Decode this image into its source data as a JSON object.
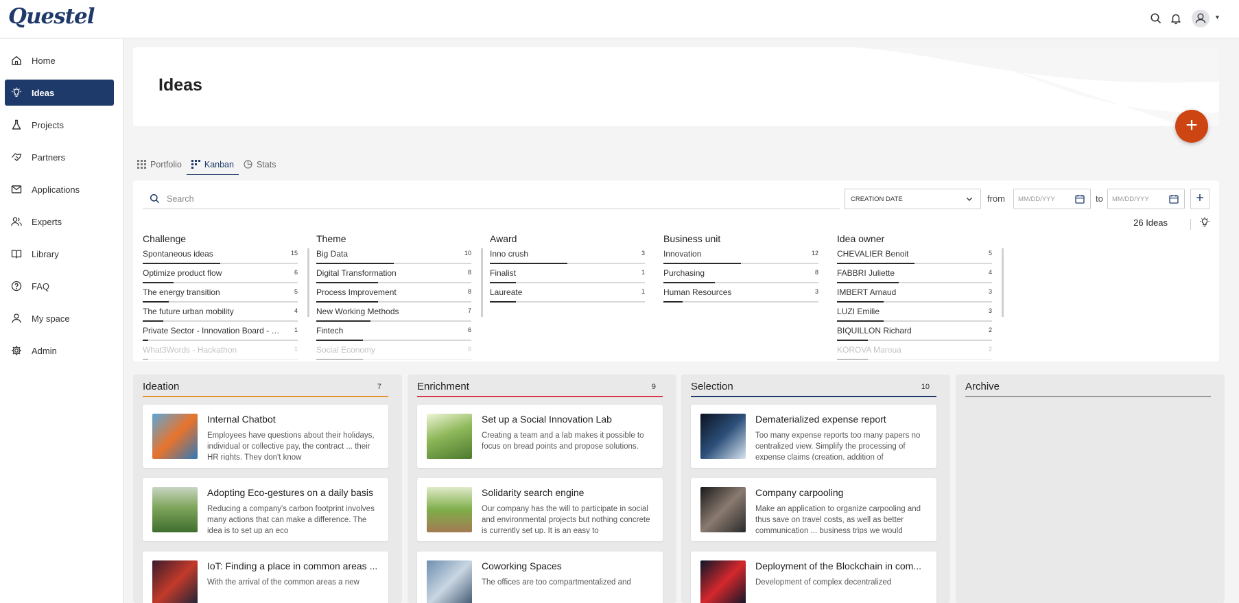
{
  "app": {
    "logo": "Questel"
  },
  "sidebar": {
    "items": [
      {
        "label": "Home",
        "icon": "home-icon"
      },
      {
        "label": "Ideas",
        "icon": "lightbulb-icon",
        "active": true
      },
      {
        "label": "Projects",
        "icon": "flask-icon"
      },
      {
        "label": "Partners",
        "icon": "handshake-icon"
      },
      {
        "label": "Applications",
        "icon": "envelope-icon"
      },
      {
        "label": "Experts",
        "icon": "users-icon"
      },
      {
        "label": "Library",
        "icon": "book-icon"
      },
      {
        "label": "FAQ",
        "icon": "question-icon"
      },
      {
        "label": "My space",
        "icon": "user-icon"
      },
      {
        "label": "Admin",
        "icon": "gear-icon"
      }
    ]
  },
  "page": {
    "title": "Ideas"
  },
  "tabs": [
    {
      "label": "Portfolio",
      "icon": "grid-icon"
    },
    {
      "label": "Kanban",
      "icon": "kanban-icon",
      "active": true
    },
    {
      "label": "Stats",
      "icon": "pie-chart-icon"
    }
  ],
  "filters": {
    "search_placeholder": "Search",
    "date_field": "CREATION DATE",
    "from_label": "from",
    "to_label": "to",
    "date_placeholder": "MM/DD/YYY",
    "ideas_count": "26 Ideas"
  },
  "facets": [
    {
      "title": "Challenge",
      "items": [
        {
          "label": "Spontaneous ideas",
          "count": 15
        },
        {
          "label": "Optimize product flow",
          "count": 6
        },
        {
          "label": "The energy transition",
          "count": 5
        },
        {
          "label": "The future urban mobility",
          "count": 4
        },
        {
          "label": "Private Sector - Innovation Board - J...",
          "count": 1
        },
        {
          "label": "What3Words - Hackathon",
          "count": 1
        }
      ]
    },
    {
      "title": "Theme",
      "items": [
        {
          "label": "Big Data",
          "count": 10
        },
        {
          "label": "Digital Transformation",
          "count": 8
        },
        {
          "label": "Process Improvement",
          "count": 8
        },
        {
          "label": "New Working Methods",
          "count": 7
        },
        {
          "label": "Fintech",
          "count": 6
        },
        {
          "label": "Social Economy",
          "count": 6
        }
      ]
    },
    {
      "title": "Award",
      "items": [
        {
          "label": "Inno crush",
          "count": 3
        },
        {
          "label": "Finalist",
          "count": 1
        },
        {
          "label": "Laureate",
          "count": 1
        }
      ]
    },
    {
      "title": "Business unit",
      "items": [
        {
          "label": "Innovation",
          "count": 12
        },
        {
          "label": "Purchasing",
          "count": 8
        },
        {
          "label": "Human Resources",
          "count": 3
        }
      ]
    },
    {
      "title": "Idea owner",
      "items": [
        {
          "label": "CHEVALIER Benoit",
          "count": 5
        },
        {
          "label": "FABBRI Juliette",
          "count": 4
        },
        {
          "label": "IMBERT Arnaud",
          "count": 3
        },
        {
          "label": "LUZI Emilie",
          "count": 3
        },
        {
          "label": "BIQUILLON Richard",
          "count": 2
        },
        {
          "label": "KOROVA Maroua",
          "count": 2
        }
      ]
    }
  ],
  "columns": [
    {
      "name": "Ideation",
      "count": "7",
      "color": "#e8922e",
      "cards": [
        {
          "title": "Internal Chatbot",
          "desc": "Employees have questions about their holidays, individual or collective pay, the contract ... their HR rights. They don't know"
        },
        {
          "title": "Adopting Eco-gestures on a daily basis",
          "desc": "Reducing a company's carbon footprint involves many actions that can make a difference. The idea is to set up an eco"
        },
        {
          "title": "IoT: Finding a place in common areas ...",
          "desc": "With the arrival of the common areas a new"
        }
      ]
    },
    {
      "name": "Enrichment",
      "count": "9",
      "color": "#d9364a",
      "cards": [
        {
          "title": "Set up a Social Innovation Lab",
          "desc": "Creating a team and a lab makes it possible to focus on bread points and propose solutions."
        },
        {
          "title": "Solidarity search engine",
          "desc": "Our company has the will to participate in social and environmental projects but nothing concrete is currently set up. It is an easy to"
        },
        {
          "title": "Coworking Spaces",
          "desc": "The offices are too compartmentalized and"
        }
      ]
    },
    {
      "name": "Selection",
      "count": "10",
      "color": "#1e3a6a",
      "cards": [
        {
          "title": "Dematerialized expense report",
          "desc": "Too many expense reports too many papers no centralized view. Simplify the processing of expense claims (creation, addition of"
        },
        {
          "title": "Company carpooling",
          "desc": "Make an application to organize carpooling and thus save on travel costs, as well as better communication ... business trips we would"
        },
        {
          "title": "Deployment of the Blockchain in com...",
          "desc": "Development of complex decentralized"
        }
      ]
    },
    {
      "name": "Archive",
      "count": "",
      "color": "#999999",
      "cards": []
    }
  ]
}
